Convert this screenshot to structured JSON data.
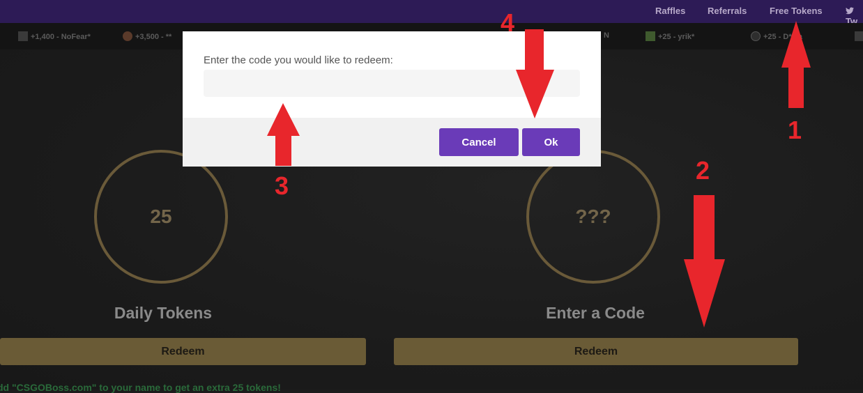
{
  "nav": {
    "links": [
      "Raffles",
      "Referrals",
      "Free Tokens"
    ],
    "twitter_label": "Tw"
  },
  "feed": [
    {
      "text": "+1,400 - NoFear*"
    },
    {
      "text": "+3,500 - **"
    },
    {
      "text": "N"
    },
    {
      "text": "+25 - yrik*"
    },
    {
      "text": "+25 - D*k.a"
    }
  ],
  "cards": [
    {
      "value": "25",
      "title": "Daily Tokens",
      "button": "Redeem"
    },
    {
      "value": "???",
      "title": "Enter a Code",
      "button": "Redeem"
    }
  ],
  "promo_text": "dd \"CSGOBoss.com\" to your name to get an extra 25 tokens!",
  "modal": {
    "label": "Enter the code you would like to redeem:",
    "input_value": "",
    "cancel_label": "Cancel",
    "ok_label": "Ok"
  },
  "annotations": [
    "1",
    "2",
    "3",
    "4"
  ],
  "colors": {
    "nav_bg": "#2d1b56",
    "accent_purple": "#6a3bb8",
    "gold": "#6a5b36",
    "annotation_red": "#e8262c"
  }
}
